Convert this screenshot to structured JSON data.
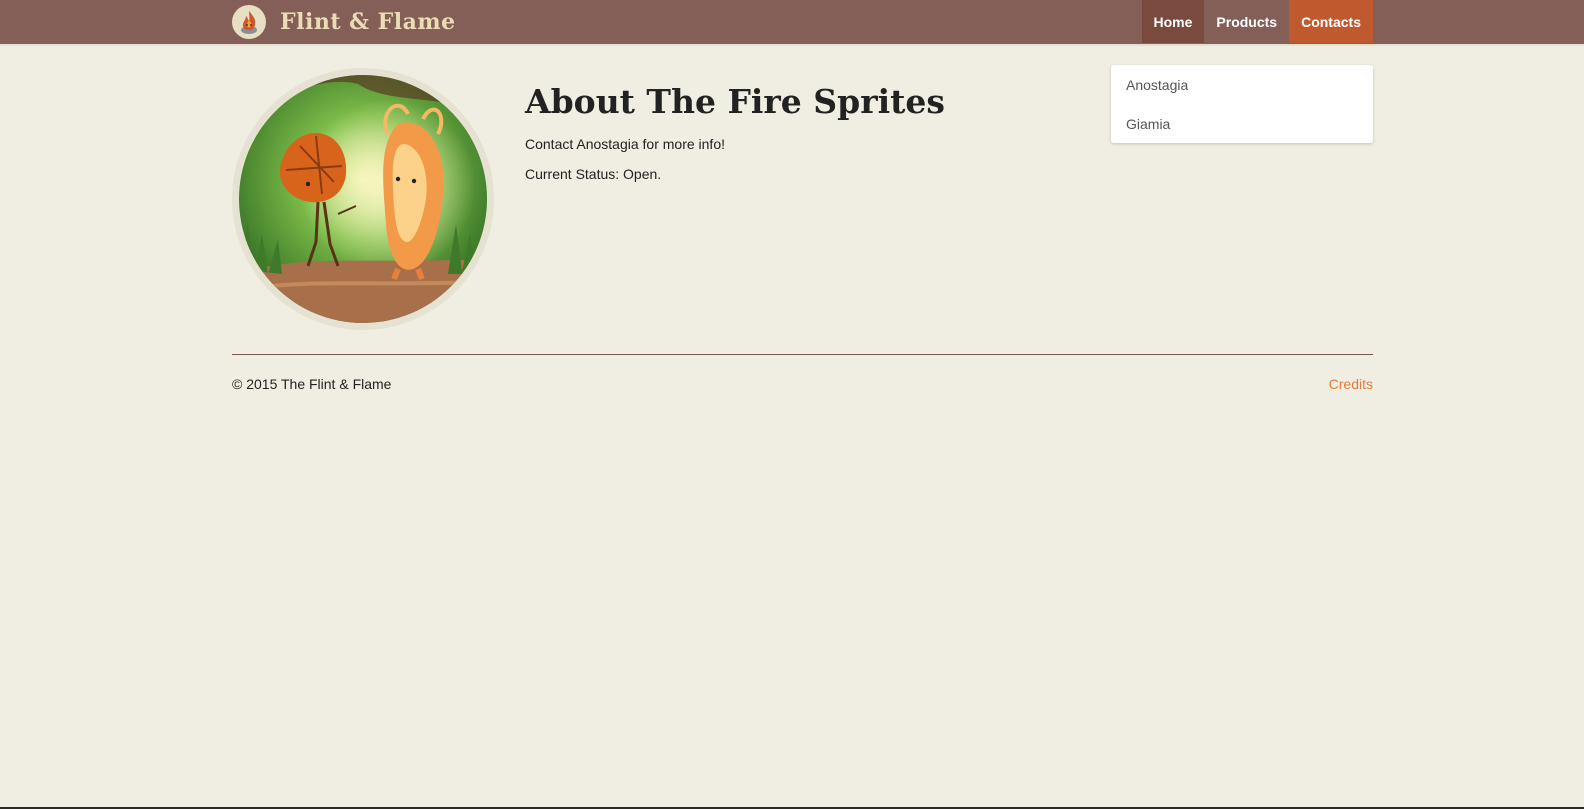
{
  "header": {
    "brand_title": "Flint & Flame",
    "logo_icon": "flame-logo-icon",
    "nav": [
      {
        "label": "Home"
      },
      {
        "label": "Products"
      },
      {
        "label": "Contacts"
      }
    ],
    "active_nav": "Contacts",
    "colors": {
      "navbar_bg": "#845f58",
      "active_nav_bg": "#c05a2e",
      "home_nav_bg": "#7a4a3e"
    }
  },
  "main": {
    "title": "About The Fire Sprites",
    "contact_text": "Contact Anostagia for more info!",
    "status_text": "Current Status: Open.",
    "image_subject": "fire sprites illustration"
  },
  "dropdown": {
    "items": [
      {
        "label": "Anostagia"
      },
      {
        "label": "Giamia"
      }
    ]
  },
  "footer": {
    "copyright": "© 2015 The Flint & Flame",
    "credits_label": "Credits",
    "credits_color": "#e67e3a"
  }
}
